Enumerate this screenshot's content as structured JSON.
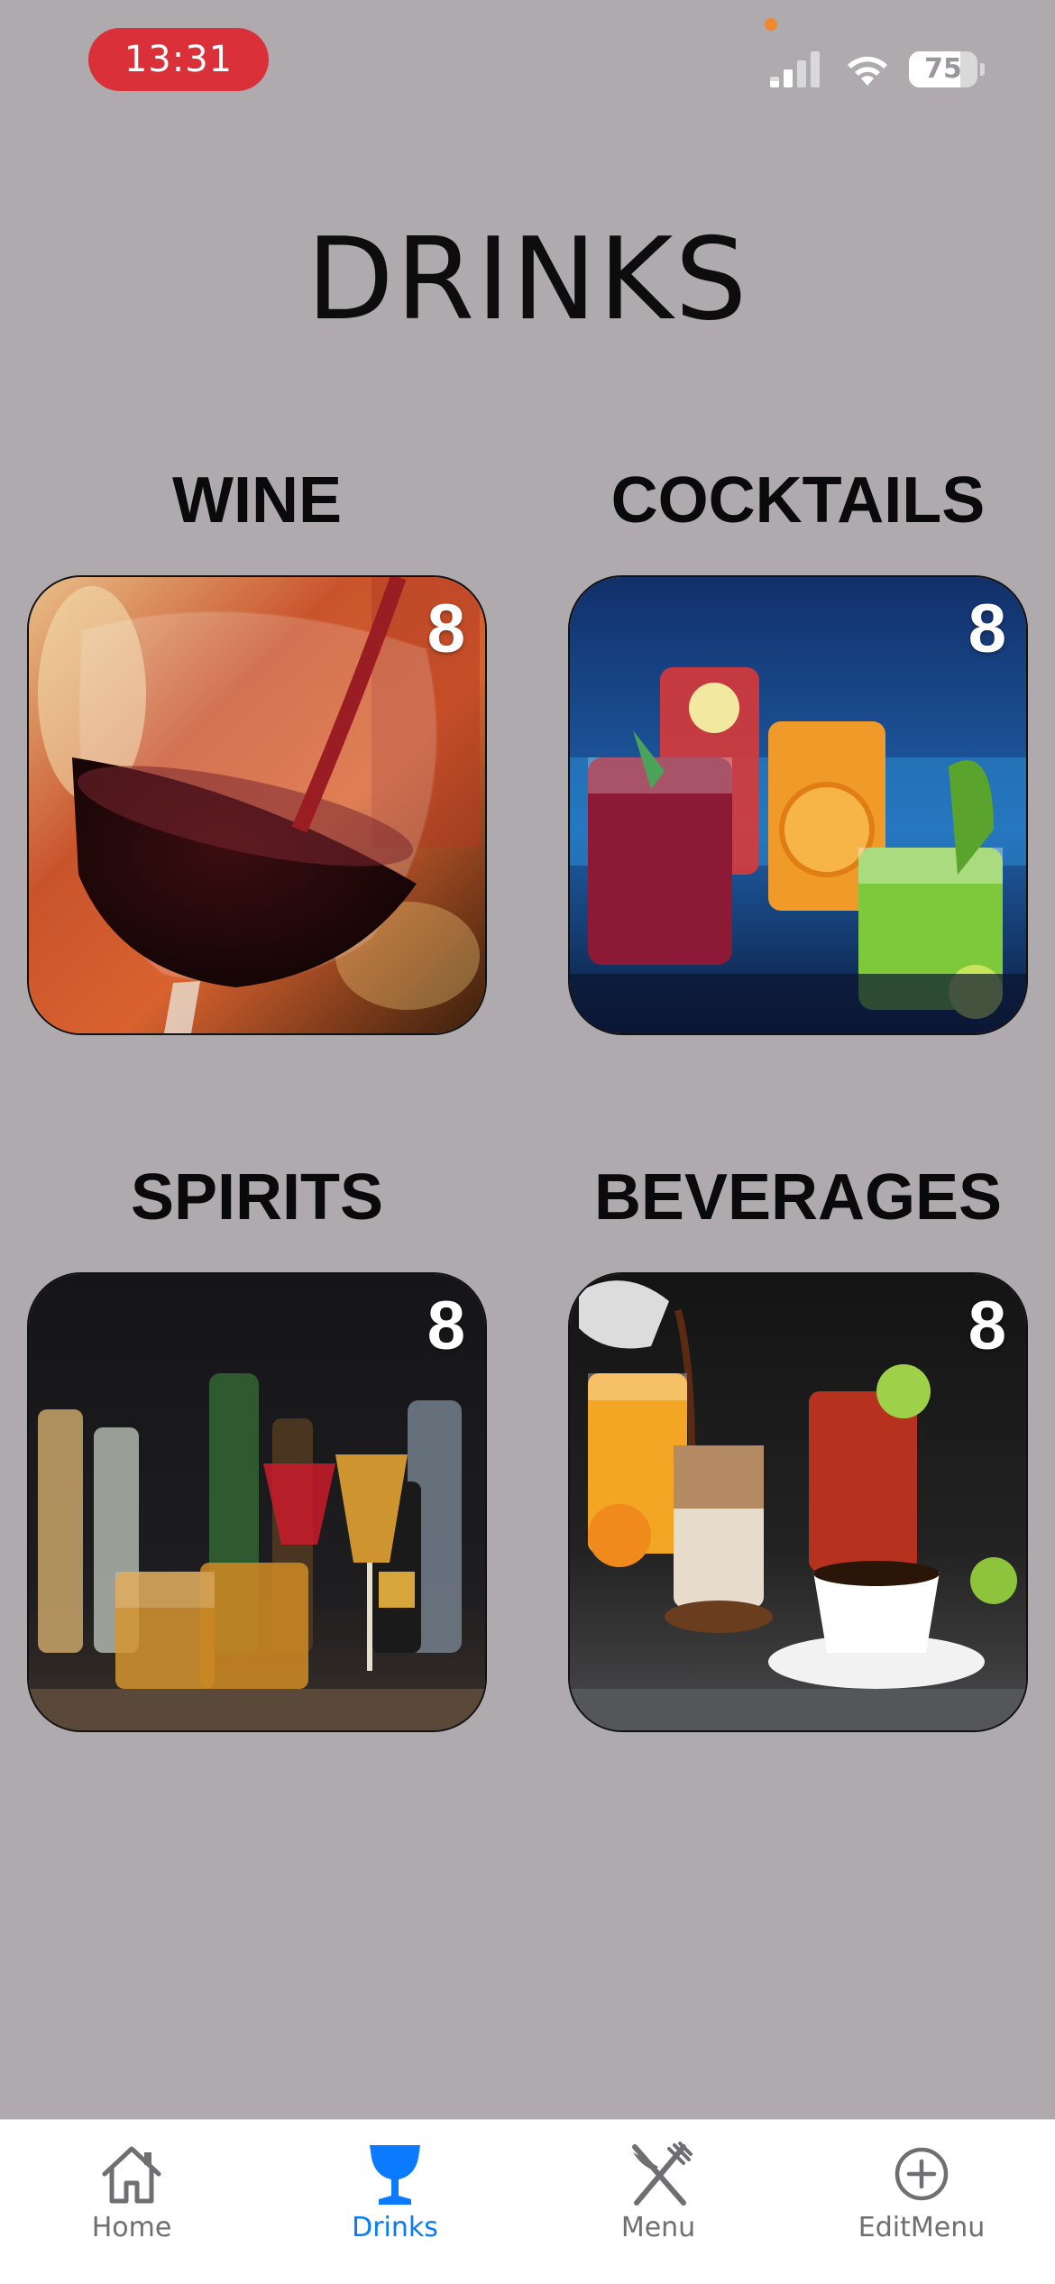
{
  "status_bar": {
    "time": "13:31",
    "battery_level": "75",
    "battery_fraction": 0.75
  },
  "page": {
    "title": "DRINKS"
  },
  "categories": [
    {
      "title": "WINE",
      "count": "8",
      "image": "red-wine-glass-photo"
    },
    {
      "title": "COCKTAILS",
      "count": "8",
      "image": "cocktails-photo"
    },
    {
      "title": "SPIRITS",
      "count": "8",
      "image": "spirits-bottles-photo"
    },
    {
      "title": "BEVERAGES",
      "count": "8",
      "image": "coffee-juice-beverages-photo"
    }
  ],
  "tab_bar": {
    "items": [
      {
        "label": "Home",
        "icon": "house-icon",
        "active": false
      },
      {
        "label": "Drinks",
        "icon": "wine-glass-icon",
        "active": true
      },
      {
        "label": "Menu",
        "icon": "fork-knife-icon",
        "active": false
      },
      {
        "label": "EditMenu",
        "icon": "plus-circle-icon",
        "active": false
      }
    ]
  },
  "colors": {
    "background": "#aeaaae",
    "accent": "#0a7aff",
    "inactive_tab": "#6e6e73",
    "time_pill": "#d9303a"
  }
}
